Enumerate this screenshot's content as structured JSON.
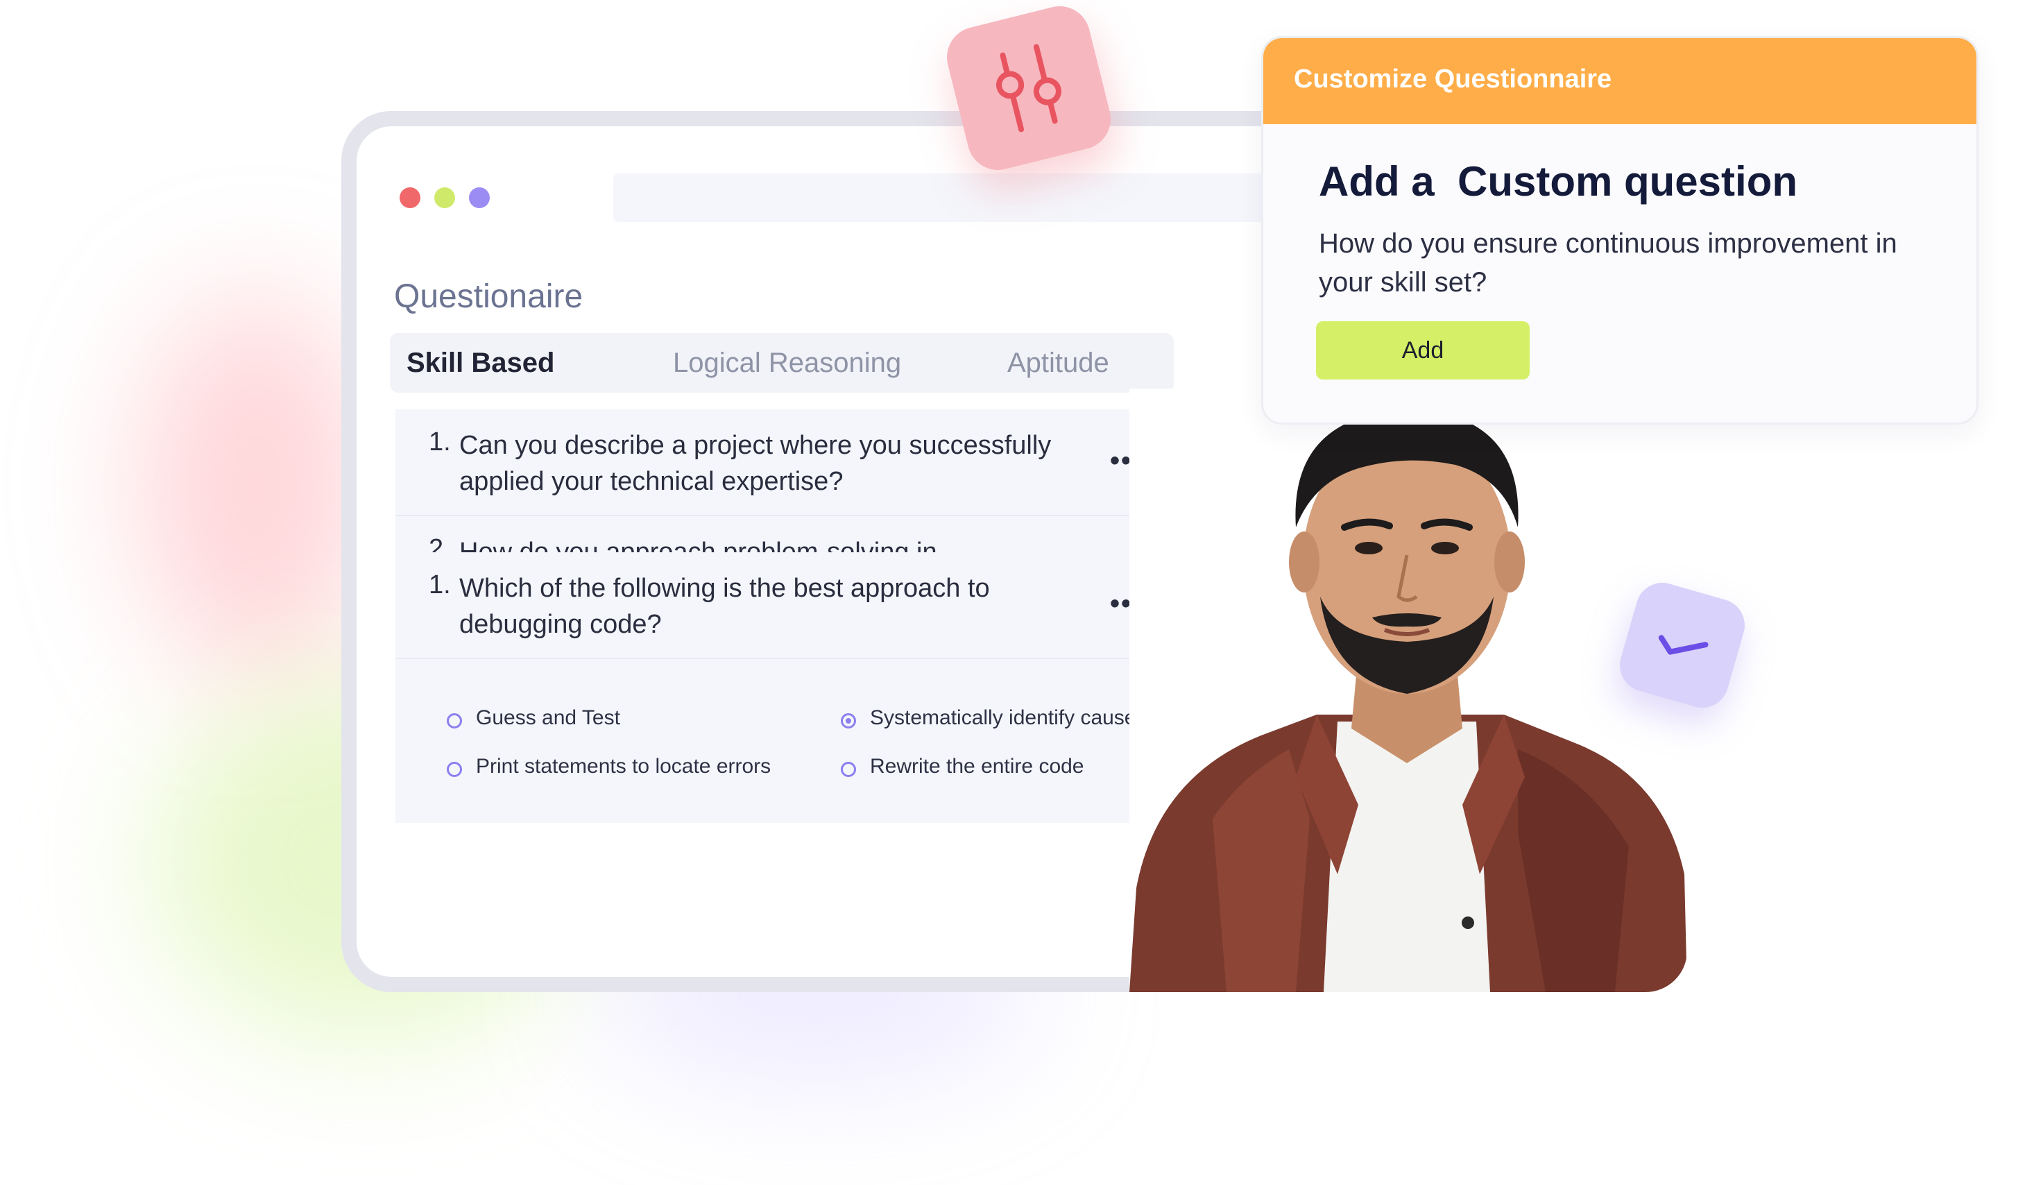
{
  "window": {
    "traffic_lights": [
      "close-dot",
      "minimize-dot",
      "zoom-dot"
    ]
  },
  "questionnaire": {
    "title": "Questionaire",
    "tabs": [
      {
        "label": "Skill Based",
        "active": true
      },
      {
        "label": "Logical Reasoning",
        "active": false
      },
      {
        "label": "Aptitude",
        "active": false
      }
    ],
    "skill_questions": [
      {
        "number": "1.",
        "text": "Can you describe a project where you successfully applied your technical expertise?"
      },
      {
        "number": "2.",
        "text": "How do you approach problem-solving in challenging situations?"
      }
    ],
    "mcq": {
      "number": "1.",
      "text": "Which of the following is the best approach to debugging code?",
      "options": [
        {
          "label": "Guess and Test",
          "selected": false
        },
        {
          "label": "Systematically identify cause",
          "selected": true
        },
        {
          "label": "Print statements to locate errors",
          "selected": false
        },
        {
          "label": "Rewrite the entire code",
          "selected": false
        }
      ]
    },
    "more_glyph": "•••"
  },
  "panel": {
    "header": "Customize Questionnaire",
    "title": "Add a  Custom question",
    "body": "How do you ensure continuous improvement in your skill set?",
    "button_label": "Add"
  },
  "colors": {
    "header_orange": "#ffad48",
    "button_lime": "#d5ef67",
    "accent_purple": "#8c7ff0",
    "badge_pink": "#f7b7bf",
    "badge_lavender": "#d9d2fa"
  },
  "icons": {
    "sliders_badge": "sliders-icon",
    "check_badge": "checkmark-icon",
    "more": "more-dots-icon"
  }
}
